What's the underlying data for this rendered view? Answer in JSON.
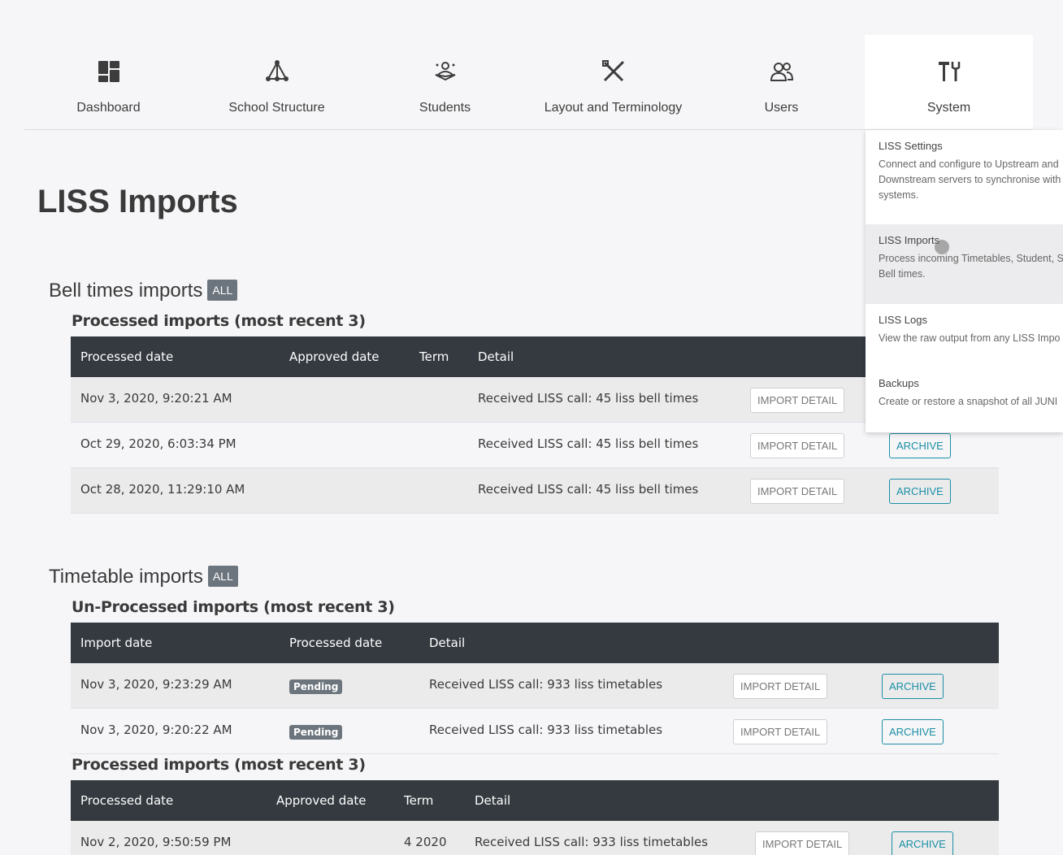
{
  "nav": {
    "items": [
      {
        "label": "Dashboard",
        "icon": "dashboard-icon"
      },
      {
        "label": "School Structure",
        "icon": "school-structure-icon"
      },
      {
        "label": "Students",
        "icon": "students-icon"
      },
      {
        "label": "Layout and Terminology",
        "icon": "layout-terminology-icon"
      },
      {
        "label": "Users",
        "icon": "users-icon"
      },
      {
        "label": "System",
        "icon": "system-tools-icon"
      }
    ],
    "active": "System"
  },
  "page": {
    "title": "LISS Imports"
  },
  "bell": {
    "title": "Bell times imports",
    "all_label": "ALL",
    "processed_title": "Processed imports (most recent 3)",
    "headers": [
      "Processed date",
      "Approved date",
      "Term",
      "Detail"
    ],
    "rows": [
      {
        "processed": "Nov 3, 2020, 9:20:21 AM",
        "approved": "",
        "term": "",
        "detail": "Received LISS call: 45 liss bell times"
      },
      {
        "processed": "Oct 29, 2020, 6:03:34 PM",
        "approved": "",
        "term": "",
        "detail": "Received LISS call: 45 liss bell times"
      },
      {
        "processed": "Oct 28, 2020, 11:29:10 AM",
        "approved": "",
        "term": "",
        "detail": "Received LISS call: 45 liss bell times"
      }
    ]
  },
  "timetable": {
    "title": "Timetable imports",
    "all_label": "ALL",
    "unprocessed_title": "Un-Processed imports (most recent 3)",
    "unprocessed_headers": [
      "Import date",
      "Processed date",
      "Detail"
    ],
    "unprocessed_rows": [
      {
        "imported": "Nov 3, 2020, 9:23:29 AM",
        "status": "Pending",
        "detail": "Received LISS call: 933 liss timetables"
      },
      {
        "imported": "Nov 3, 2020, 9:20:22 AM",
        "status": "Pending",
        "detail": "Received LISS call: 933 liss timetables"
      }
    ],
    "processed_title": "Processed imports (most recent 3)",
    "processed_headers": [
      "Processed date",
      "Approved date",
      "Term",
      "Detail"
    ],
    "processed_rows": [
      {
        "processed": "Nov 2, 2020, 9:50:59 PM",
        "approved": "",
        "term": "4 2020",
        "detail": "Received LISS call: 933 liss timetables"
      }
    ]
  },
  "buttons": {
    "import_detail": "IMPORT DETAIL",
    "archive": "ARCHIVE"
  },
  "dropdown": {
    "items": [
      {
        "title": "LISS Settings",
        "desc": [
          "Connect and configure to Upstream and",
          "Downstream servers to synchronise with",
          "systems."
        ]
      },
      {
        "title": "LISS Imports",
        "desc": [
          "Process incoming Timetables, Student, S",
          "Bell times."
        ]
      },
      {
        "title": "LISS Logs",
        "desc": [
          "View the raw output from any LISS Impo"
        ]
      },
      {
        "title": "Backups",
        "desc": [
          "Create or restore a snapshot of all JUNI"
        ]
      }
    ],
    "hovered": "LISS Imports"
  },
  "colors": {
    "header_dark": "#343a40",
    "archive_teal": "#1a8fa5",
    "badge_gray": "#6c757d"
  }
}
